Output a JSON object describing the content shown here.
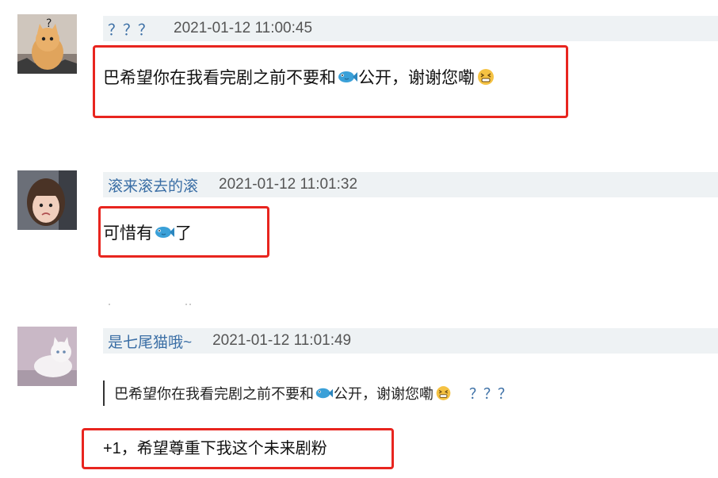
{
  "comments": [
    {
      "username": "？？？",
      "timestamp": "2021-01-12 11:00:45",
      "text_before": "巴希望你在我看完剧之前不要和",
      "text_after": "公开，谢谢您嘞",
      "emoji_1": "fish-emoji",
      "emoji_2": "grimace-emoji"
    },
    {
      "username": "滚来滚去的滚",
      "timestamp": "2021-01-12 11:01:32",
      "text_before": "可惜有",
      "text_after": "了",
      "emoji_1": "fish-emoji"
    },
    {
      "username": "是七尾猫哦~",
      "timestamp": "2021-01-12 11:01:49",
      "quote_before": "巴希望你在我看完剧之前不要和",
      "quote_after": "公开，谢谢您嘞",
      "quote_user": "？？？",
      "text": "+1，希望尊重下我这个未来剧粉"
    }
  ],
  "colors": {
    "highlight": "#e8251f",
    "username": "#3a6ea5",
    "meta_background": "#eef2f4"
  }
}
